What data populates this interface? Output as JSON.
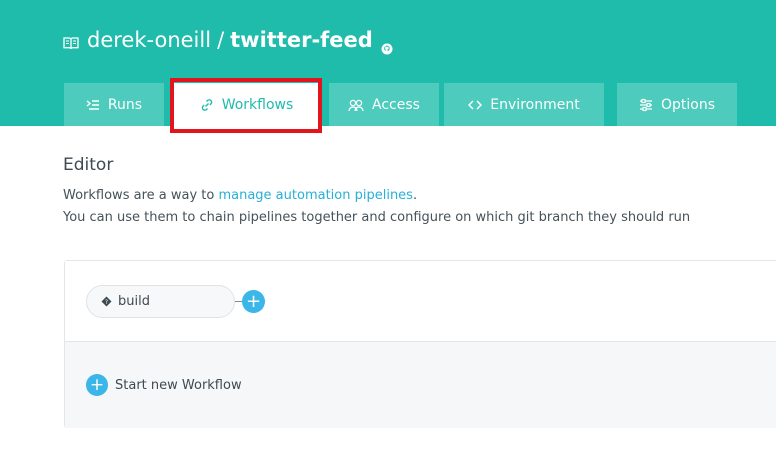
{
  "header": {
    "owner": "derek-oneill",
    "separator": "/",
    "repo": "twitter-feed",
    "owner_icon": "book-icon",
    "repo_icon": "github-icon",
    "background_color": "#20bcab"
  },
  "tabs": [
    {
      "label": "Runs",
      "icon": "runs-icon",
      "active": false
    },
    {
      "label": "Workflows",
      "icon": "workflows-icon",
      "active": true
    },
    {
      "label": "Access",
      "icon": "access-icon",
      "active": false
    },
    {
      "label": "Environment",
      "icon": "code-icon",
      "active": false
    },
    {
      "label": "Options",
      "icon": "options-icon",
      "active": false
    }
  ],
  "highlight_color": "#e2151c",
  "editor": {
    "title": "Editor",
    "description_prefix": "Workflows are a way to ",
    "description_link": "manage automation pipelines",
    "description_suffix": ".",
    "description_line2": "You can use them to chain pipelines together and configure on which git branch they should run"
  },
  "workflow": {
    "pipeline_label": "build",
    "pipeline_icon": "pipeline-icon",
    "add_symbol": "+"
  },
  "start_new": {
    "symbol": "+",
    "label": "Start new Workflow"
  },
  "accent_color": "#3ab6e8"
}
